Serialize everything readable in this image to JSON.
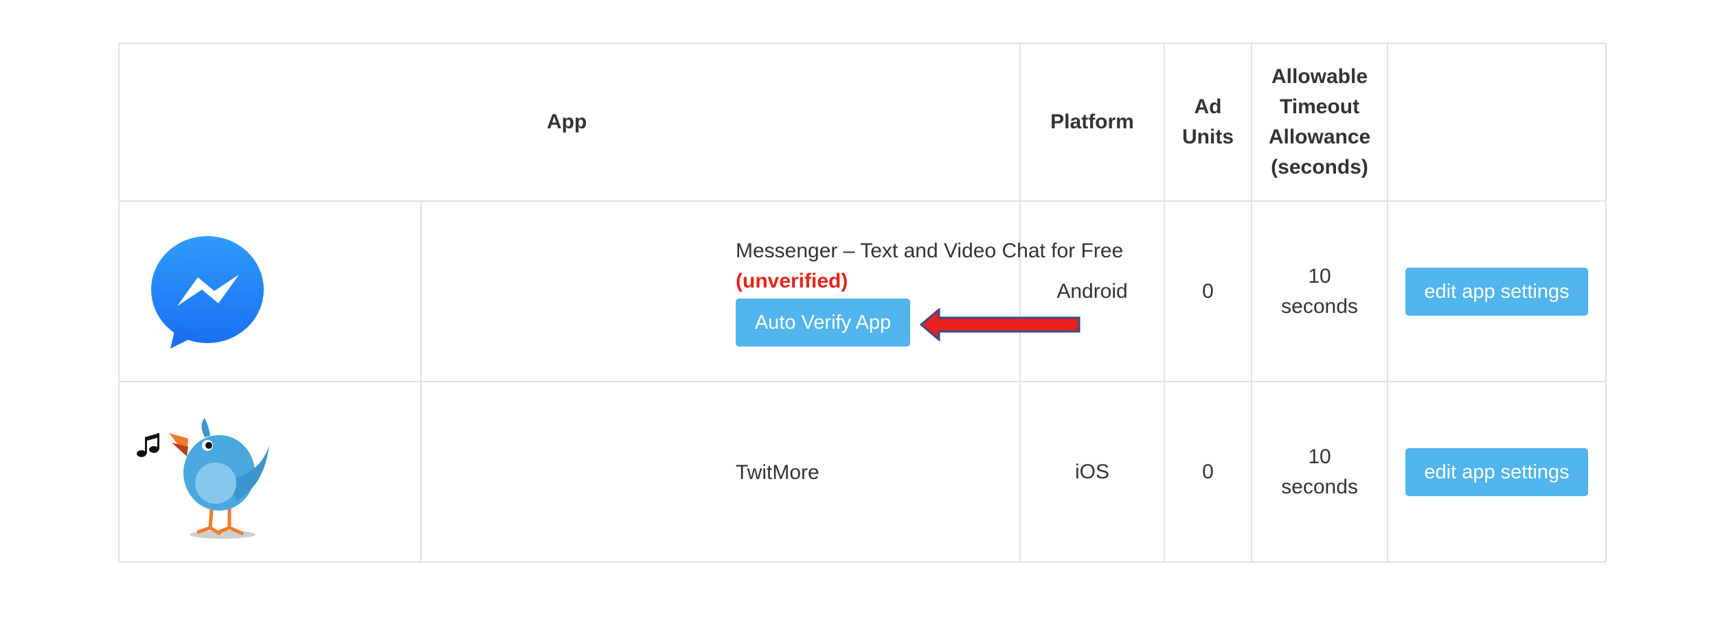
{
  "table": {
    "headers": {
      "app": "App",
      "platform": "Platform",
      "ad_units": "Ad Units",
      "timeout": "Allowable Timeout Allowance (seconds)",
      "actions": ""
    },
    "rows": [
      {
        "icon": "messenger-icon",
        "name": "Messenger – Text and Video Chat for Free",
        "status": "(unverified)",
        "verify_label": "Auto Verify App",
        "platform": "Android",
        "ad_units": "0",
        "timeout_value": "10",
        "timeout_unit": "seconds",
        "edit_label": "edit app settings"
      },
      {
        "icon": "singing-bird-icon",
        "name": "TwitMore",
        "platform": "iOS",
        "ad_units": "0",
        "timeout_value": "10",
        "timeout_unit": "seconds",
        "edit_label": "edit app settings"
      }
    ]
  },
  "colors": {
    "button": "#51b4ec",
    "unverified": "#e8231b",
    "arrow_fill": "#e8231b",
    "arrow_outline": "#3a4a8c",
    "messenger_blue": "#1f86f7"
  }
}
